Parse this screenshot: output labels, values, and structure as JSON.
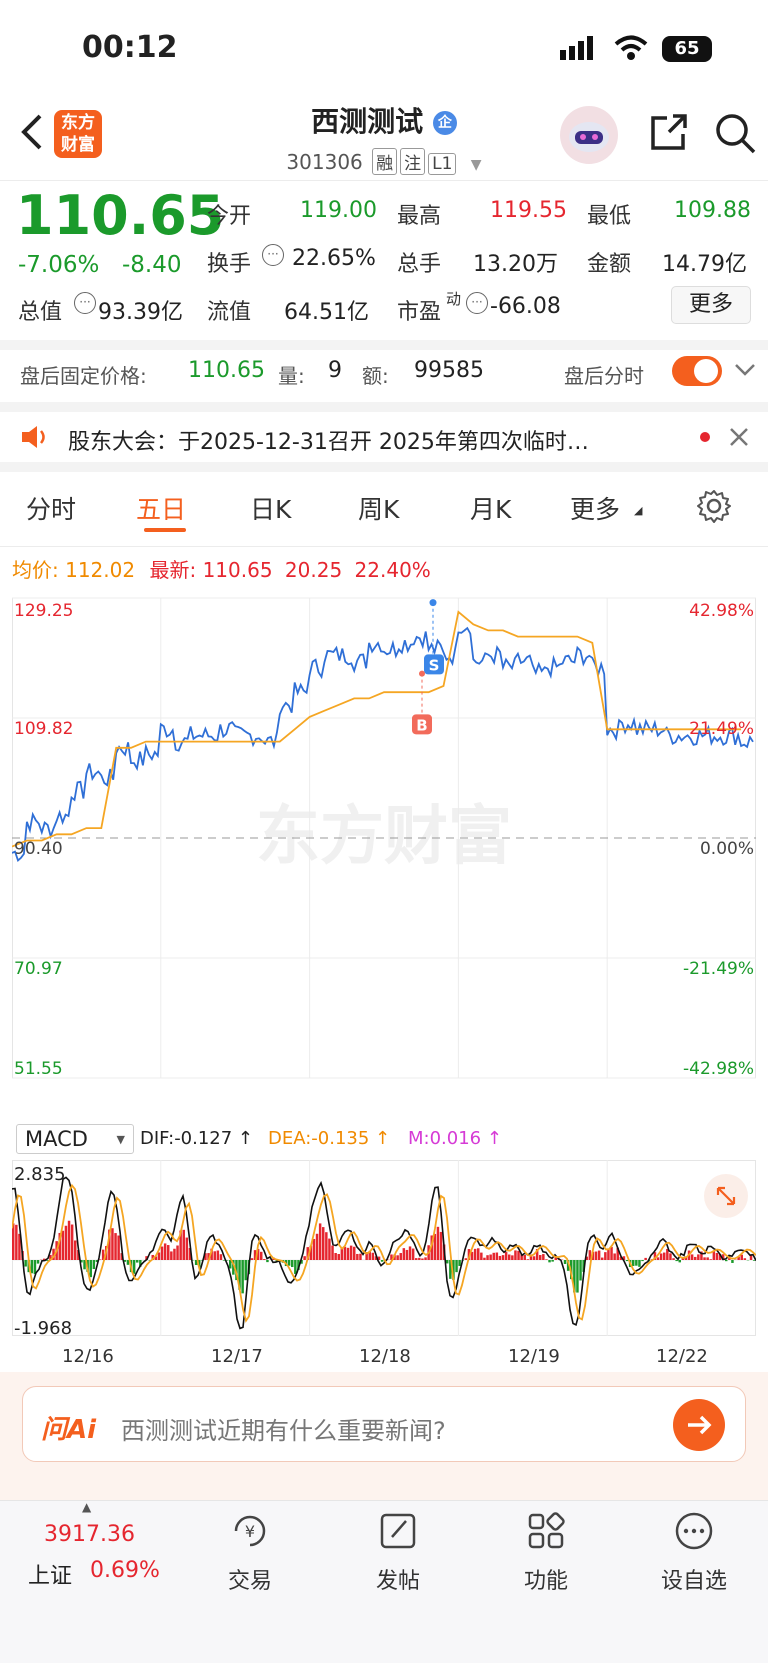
{
  "status_bar": {
    "time": "00:12",
    "battery": "65"
  },
  "header": {
    "logo_line1": "东方",
    "logo_line2": "财富",
    "stock_name": "西测测试",
    "name_badge": "企",
    "stock_code": "301306",
    "tags": [
      "融",
      "注",
      "L1"
    ]
  },
  "quote": {
    "price": "110.65",
    "change_pct": "-7.06%",
    "change_amt": "-8.40",
    "open_label": "今开",
    "open": "119.00",
    "high_label": "最高",
    "high": "119.55",
    "low_label": "最低",
    "low": "109.88",
    "turnover_label": "换手",
    "turnover": "22.65%",
    "volume_label": "总手",
    "volume": "13.20万",
    "amount_label": "金额",
    "amount": "14.79亿",
    "total_value_label": "总值",
    "total_value": "93.39亿",
    "float_value_label": "流值",
    "float_value": "64.51亿",
    "pe_label": "市盈",
    "pe_sup": "动",
    "pe": "-66.08",
    "more_button": "更多"
  },
  "after_hours": {
    "label": "盘后固定价格:",
    "price": "110.65",
    "vol_label": "量:",
    "vol": "9",
    "amt_label": "额:",
    "amt": "99585",
    "toggle_label": "盘后分时",
    "toggle_on": true
  },
  "notice": {
    "text": "股东大会：于2025-12-31召开 2025年第四次临时…"
  },
  "chart_tabs": [
    "分时",
    "五日",
    "日K",
    "周K",
    "月K",
    "更多"
  ],
  "active_tab": "五日",
  "info_line": {
    "avg_label": "均价:",
    "avg": "112.02",
    "latest_label": "最新:",
    "latest": "110.65",
    "chg": "20.25",
    "chg_pct": "22.40%"
  },
  "watermark": "东方财富",
  "chart_data": {
    "type": "line",
    "y_labels_left": [
      "129.25",
      "109.82",
      "90.40",
      "70.97",
      "51.55"
    ],
    "y_labels_right": [
      "42.98%",
      "21.49%",
      "0.00%",
      "-21.49%",
      "-42.98%"
    ],
    "ylim": [
      51.55,
      129.25
    ],
    "x_labels": [
      "12/16",
      "12/17",
      "12/18",
      "12/19",
      "12/22"
    ],
    "series": [
      {
        "name": "price",
        "color": "#2f6fd6",
        "values": [
          88,
          93,
          92,
          94,
          98,
          101,
          100,
          105,
          103,
          104,
          108,
          106,
          107,
          107,
          108,
          107,
          107,
          106,
          112,
          114,
          118,
          120,
          120,
          119,
          122,
          121,
          122,
          123,
          121,
          120,
          125,
          119,
          120,
          118,
          119,
          117,
          118,
          119,
          120,
          118,
          108,
          109,
          108,
          108,
          107,
          107,
          107,
          107,
          107,
          106
        ]
      },
      {
        "name": "avg",
        "color": "#f5a623",
        "values": [
          89,
          90,
          90,
          91,
          91,
          92,
          92,
          105,
          105,
          106,
          106,
          106,
          106,
          106,
          106,
          106,
          106,
          106,
          106,
          108,
          110,
          111,
          112,
          113,
          113,
          114,
          114,
          114,
          114,
          115,
          127,
          125,
          124,
          124,
          123,
          123,
          123,
          123,
          123,
          122,
          108,
          108,
          108,
          108,
          108,
          108,
          108,
          108,
          108,
          108
        ]
      }
    ],
    "markers": [
      {
        "label": "S",
        "color": "#3a86e8"
      },
      {
        "label": "B",
        "color": "#f26b5b"
      }
    ]
  },
  "macd": {
    "selector": "MACD",
    "dif_label": "DIF:-0.127 ↑",
    "dea_label": "DEA:-0.135 ↑",
    "m_label": "M:0.016 ↑",
    "top": "2.835",
    "bottom": "-1.968"
  },
  "ai_bar": {
    "logo": "问Ai",
    "placeholder": "西测测试近期有什么重要新闻?"
  },
  "bottom_nav": {
    "index_value": "3917.36",
    "index_name": "上证",
    "index_pct": "0.69%",
    "items": [
      "交易",
      "发帖",
      "功能",
      "设自选"
    ]
  }
}
